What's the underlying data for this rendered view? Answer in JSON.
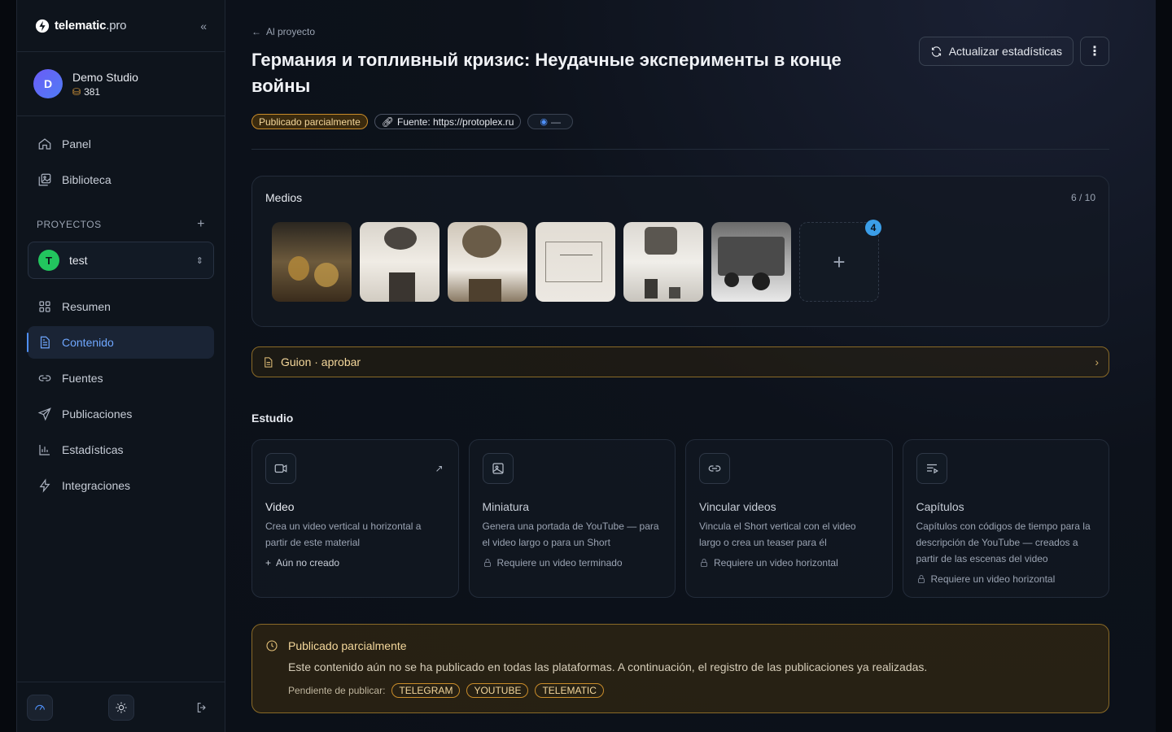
{
  "brand": {
    "name": "telematic",
    "suffix": ".pro"
  },
  "studio": {
    "initial": "D",
    "name": "Demo Studio",
    "credits": "381"
  },
  "nav_top": [
    {
      "label": "Panel",
      "icon": "home-icon"
    },
    {
      "label": "Biblioteca",
      "icon": "library-icon"
    }
  ],
  "projects": {
    "header": "PROYECTOS",
    "current": {
      "initial": "T",
      "name": "test"
    }
  },
  "nav_project": [
    {
      "label": "Resumen",
      "icon": "grid-icon"
    },
    {
      "label": "Contenido",
      "icon": "document-icon",
      "active": true
    },
    {
      "label": "Fuentes",
      "icon": "link-icon"
    },
    {
      "label": "Publicaciones",
      "icon": "send-icon"
    },
    {
      "label": "Estadísticas",
      "icon": "chart-icon"
    },
    {
      "label": "Integraciones",
      "icon": "zap-icon"
    }
  ],
  "main": {
    "back_label": "Al proyecto",
    "title": "Германия и топливный кризис: Неудачные эксперименты в конце войны",
    "refresh_label": "Actualizar estadísticas",
    "badges": {
      "status": "Publicado parcialmente",
      "source": "Fuente: https://protoplex.ru",
      "views": "—"
    },
    "media": {
      "title": "Medios",
      "count": "6 / 10",
      "add_badge": "4"
    },
    "script": {
      "label": "Guion · aprobar"
    },
    "studio_section": "Estudio",
    "tools": [
      {
        "title": "Video",
        "desc": "Crea un video vertical u horizontal a partir de este material",
        "foot": "Aún no creado",
        "icon": "video-icon"
      },
      {
        "title": "Miniatura",
        "desc": "Genera una portada de YouTube — para el video largo o para un Short",
        "foot": "Requiere un video terminado",
        "icon": "image-icon"
      },
      {
        "title": "Vincular videos",
        "desc": "Vincula el Short vertical con el video largo o crea un teaser para él",
        "foot": "Requiere un video horizontal",
        "icon": "link-icon"
      },
      {
        "title": "Capítulos",
        "desc": "Capítulos con códigos de tiempo para la descripción de YouTube — creados a partir de las escenas del video",
        "foot": "Requiere un video horizontal",
        "icon": "chapters-icon"
      }
    ],
    "publication": {
      "title": "Publicado parcialmente",
      "text": "Este contenido aún no se ha publicado en todas las plataformas. A continuación, el registro de las publicaciones ya realizadas.",
      "pending_label": "Pendiente de publicar:",
      "platforms": [
        "TELEGRAM",
        "YOUTUBE",
        "TELEMATIC"
      ]
    }
  },
  "colors": {
    "accent": "#4e8ff7",
    "warning": "#c98c2a",
    "success": "#22c55e"
  }
}
